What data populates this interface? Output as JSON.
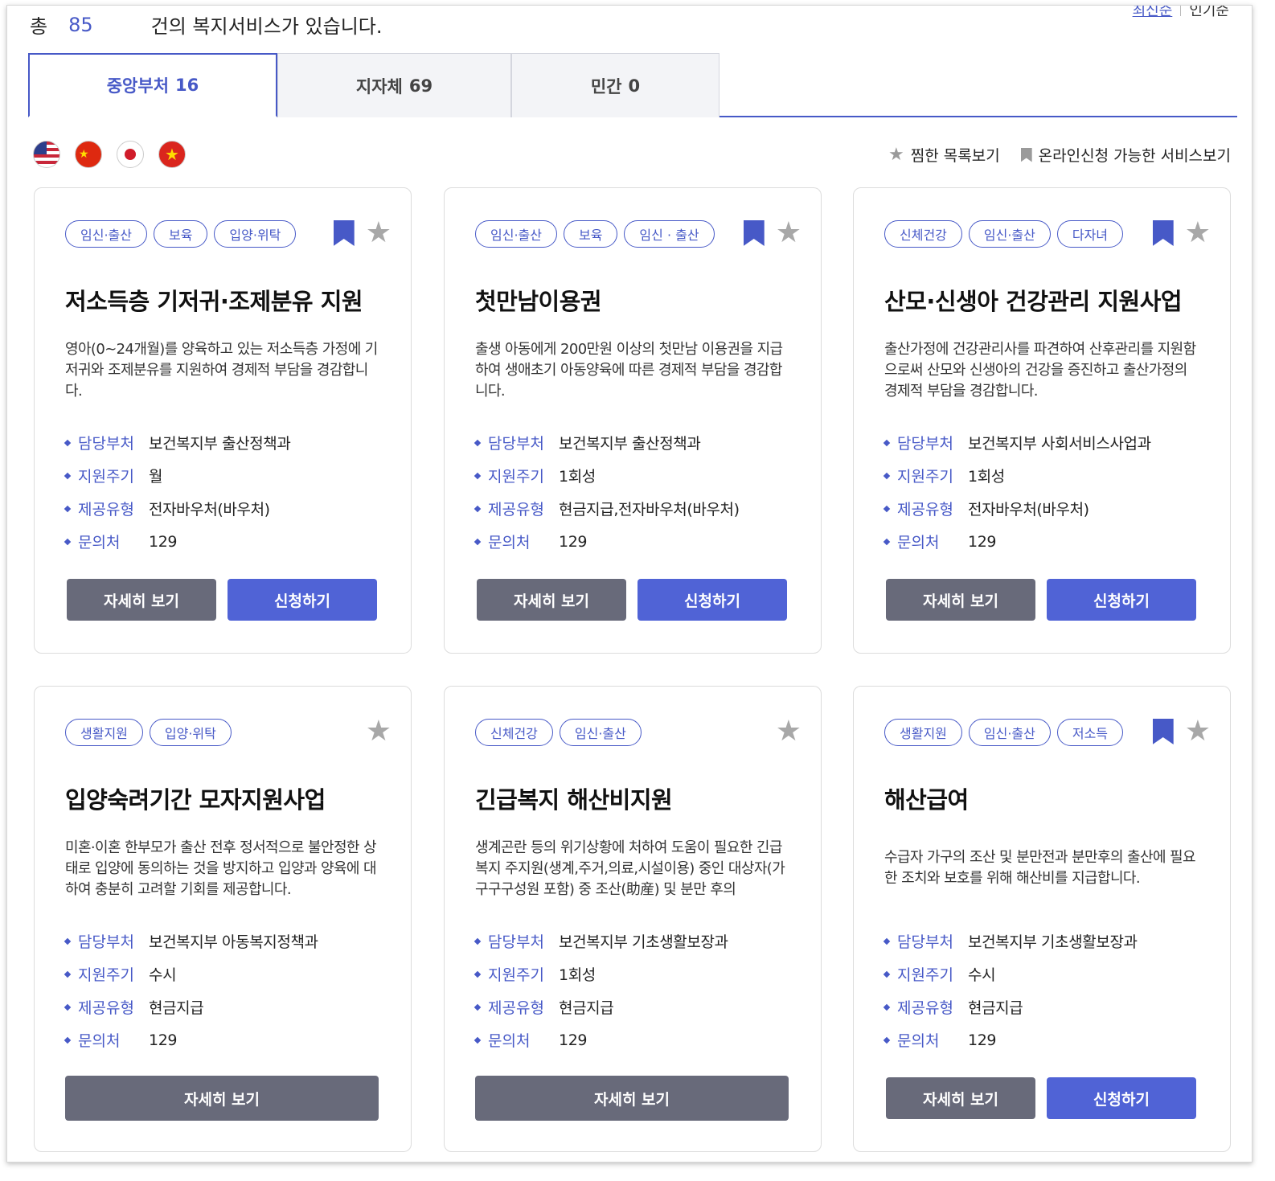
{
  "summary": {
    "prefix": "총",
    "count": "85",
    "suffix": "건의 복지서비스가 있습니다."
  },
  "sort": {
    "latest": "최신순",
    "popular": "인기순"
  },
  "tabs": [
    {
      "label": "중앙부처",
      "count": "16"
    },
    {
      "label": "지자체",
      "count": "69"
    },
    {
      "label": "민간",
      "count": "0"
    }
  ],
  "languages": [
    "english-flag",
    "chinese-flag",
    "japanese-flag",
    "vietnamese-flag"
  ],
  "filters": {
    "favorites": "찜한 목록보기",
    "online": "온라인신청 가능한 서비스보기"
  },
  "labels": {
    "dept": "담당부처",
    "cycle": "지원주기",
    "type": "제공유형",
    "contact": "문의처",
    "detail": "자세히 보기",
    "apply": "신청하기"
  },
  "colors": {
    "accent": "#4759c7",
    "detail_button": "#686a7a",
    "apply_button": "#5063d6",
    "star": "#a8a8a8"
  },
  "cards": [
    {
      "tags": [
        "임신·출산",
        "보육",
        "입양·위탁"
      ],
      "title": "저소득층 기저귀·조제분유 지원",
      "desc": "영아(0~24개월)를 양육하고 있는 저소득층 가정에 기저귀와 조제분유를 지원하여 경제적 부담을 경감합니다.",
      "dept": "보건복지부 출산정책과",
      "cycle": "월",
      "type": "전자바우처(바우처)",
      "contact": "129"
    },
    {
      "tags": [
        "임신·출산",
        "보육",
        "임신 · 출산"
      ],
      "title": "첫만남이용권",
      "desc": "출생 아동에게 200만원 이상의 첫만남 이용권을 지급하여 생애초기 아동양육에 따른 경제적 부담을 경감합니다.",
      "dept": "보건복지부 출산정책과",
      "cycle": "1회성",
      "type": "현금지급,전자바우처(바우처)",
      "contact": "129"
    },
    {
      "tags": [
        "신체건강",
        "임신·출산",
        "다자녀"
      ],
      "title": "산모·신생아 건강관리 지원사업",
      "desc": "출산가정에 건강관리사를 파견하여 산후관리를 지원함으로써 산모와 신생아의 건강을 증진하고 출산가정의 경제적 부담을 경감합니다.",
      "dept": "보건복지부 사회서비스사업과",
      "cycle": "1회성",
      "type": "전자바우처(바우처)",
      "contact": "129"
    },
    {
      "tags": [
        "생활지원",
        "입양·위탁"
      ],
      "title": "입양숙려기간 모자지원사업",
      "desc": "미혼·이혼 한부모가 출산 전후 정서적으로 불안정한 상태로 입양에 동의하는 것을 방지하고 입양과 양육에 대하여 충분히 고려할 기회를 제공합니다.",
      "dept": "보건복지부 아동복지정책과",
      "cycle": "수시",
      "type": "현금지급",
      "contact": "129"
    },
    {
      "tags": [
        "신체건강",
        "임신·출산"
      ],
      "title": "긴급복지 해산비지원",
      "desc": "생계곤란 등의 위기상황에 처하여 도움이 필요한 긴급복지 주지원(생계,주거,의료,시설이용) 중인 대상자(가구구구성원 포함) 중 조산(助産) 및 분만 후의",
      "dept": "보건복지부 기초생활보장과",
      "cycle": "1회성",
      "type": "현금지급",
      "contact": "129"
    },
    {
      "tags": [
        "생활지원",
        "임신·출산",
        "저소득"
      ],
      "title": "해산급여",
      "desc": "수급자 가구의 조산 및 분만전과 분만후의 출산에 필요한 조치와 보호를 위해 해산비를 지급합니다.",
      "dept": "보건복지부 기초생활보장과",
      "cycle": "수시",
      "type": "현금지급",
      "contact": "129"
    }
  ]
}
